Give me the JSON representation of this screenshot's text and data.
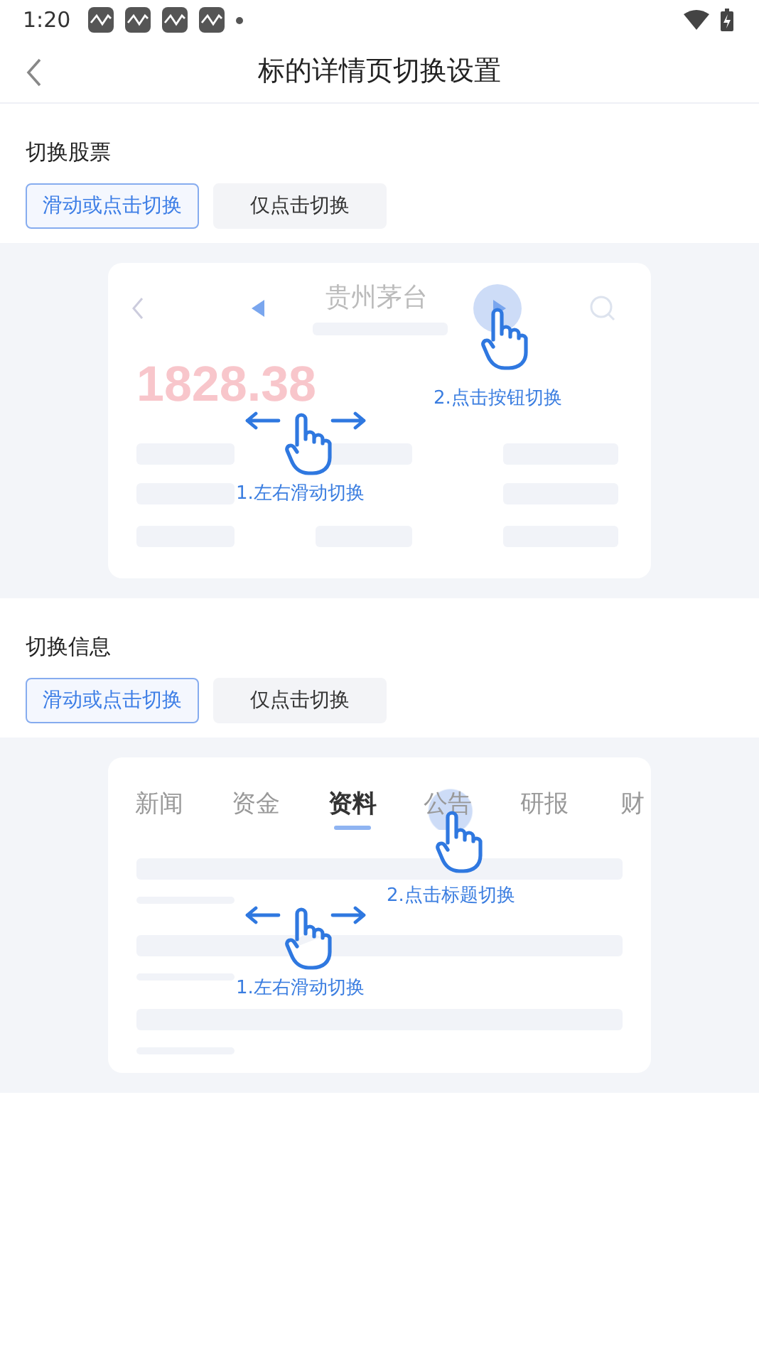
{
  "status_bar": {
    "time": "1:20"
  },
  "header": {
    "title": "标的详情页切换设置"
  },
  "sections": [
    {
      "title": "切换股票",
      "options": [
        {
          "label": "滑动或点击切换",
          "selected": true
        },
        {
          "label": "仅点击切换",
          "selected": false
        }
      ],
      "demo": {
        "kind": "stock",
        "stock_name": "贵州茅台",
        "price": "1828.38",
        "tap_hint": "2.点击按钮切换",
        "swipe_hint": "1.左右滑动切换"
      }
    },
    {
      "title": "切换信息",
      "options": [
        {
          "label": "滑动或点击切换",
          "selected": true
        },
        {
          "label": "仅点击切换",
          "selected": false
        }
      ],
      "demo": {
        "kind": "tabs",
        "tabs": [
          {
            "label": "新闻",
            "selected": false,
            "tapped": false
          },
          {
            "label": "资金",
            "selected": false,
            "tapped": false
          },
          {
            "label": "资料",
            "selected": true,
            "tapped": false
          },
          {
            "label": "公告",
            "selected": false,
            "tapped": true
          },
          {
            "label": "研报",
            "selected": false,
            "tapped": false
          },
          {
            "label": "财",
            "selected": false,
            "tapped": false
          }
        ],
        "tap_hint": "2.点击标题切换",
        "swipe_hint": "1.左右滑动切换"
      }
    }
  ]
}
